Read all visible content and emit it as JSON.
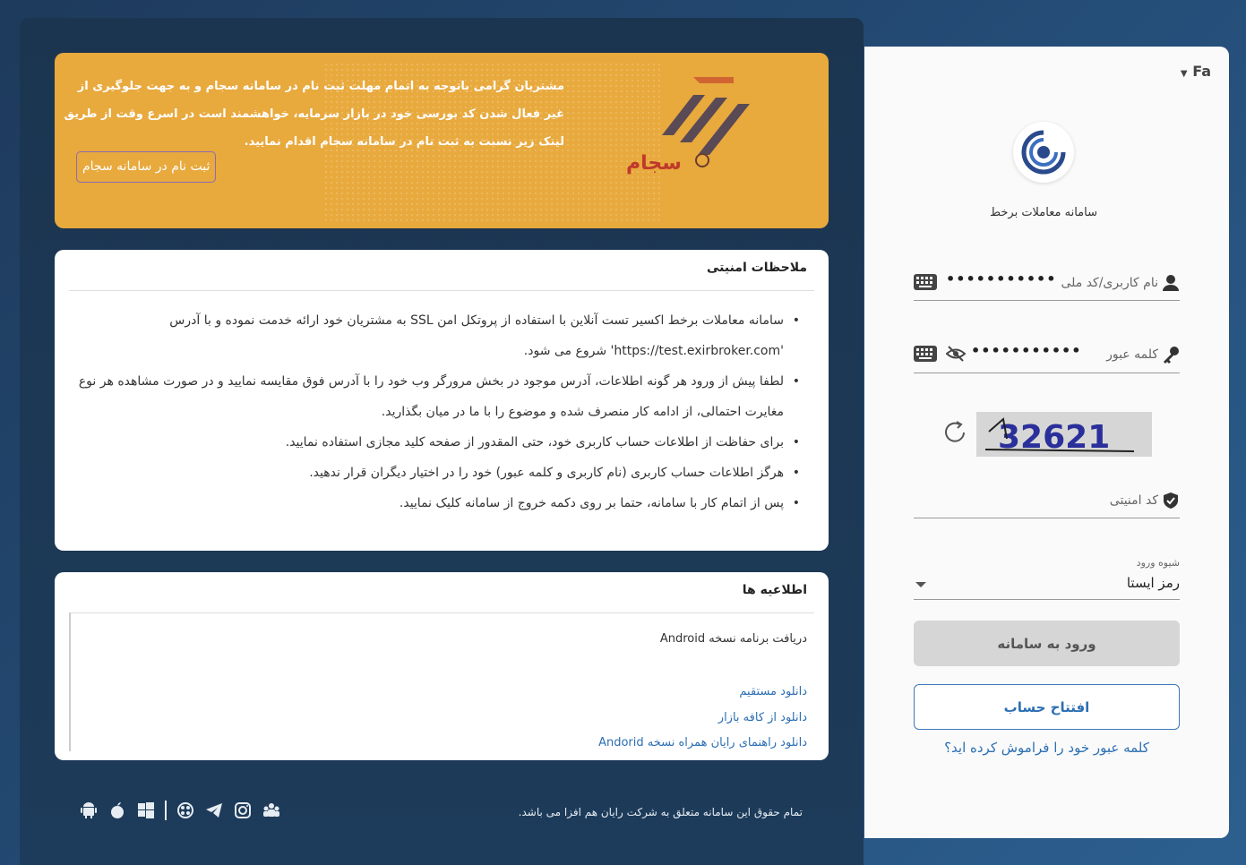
{
  "banner": {
    "text": "مشتریان گرامی باتوجه به اتمام مهلت ثبت نام در سامانه سجام و به جهت جلوگیری از غیر فعال شدن کد بورسی خود در بازار سرمایه، خواهشمند است در اسرع وقت از طریق لینک زیر نسبت به ثبت نام در سامانه سجام اقدام نمایید.",
    "button_label": "ثبت نام در سامانه سجام",
    "logo_text": "سجام"
  },
  "security": {
    "title": "ملاحظات امنیتی",
    "items": [
      "سامانه معاملات برخط اکسیر تست آنلاین با استفاده از پروتکل امن SSL به مشتریان خود ارائه خدمت نموده و با آدرس 'https://test.exirbroker.com' شروع می شود.",
      "لطفا پیش از ورود هر گونه اطلاعات، آدرس موجود در بخش مرورگر وب خود را با آدرس فوق مقایسه نمایید و در صورت مشاهده هر نوع مغایرت احتمالی، از ادامه کار منصرف شده و موضوع را با ما در میان بگذارید.",
      "برای حفاظت از اطلاعات حساب کاربری خود، حتی المقدور از صفحه کلید مجازی استفاده نمایید.",
      "هرگز اطلاعات حساب کاربری (نام کاربری و کلمه عبور) خود را در اختیار دیگران قرار ندهید.",
      "پس از اتمام کار با سامانه، حتما بر روی دکمه خروج از سامانه کلیک نمایید."
    ]
  },
  "news": {
    "title": "اطلاعیه ها",
    "heading": "دریافت برنامه نسخه Android",
    "links": [
      "دانلود مستقیم",
      "دانلود از کافه بازار",
      "دانلود راهنمای رایان همراه نسخه Andorid"
    ]
  },
  "footer": {
    "copyright": "تمام حقوق این سامانه متعلق به شرکت رایان هم افزا می باشد."
  },
  "login": {
    "lang": "Fa",
    "app_name": "سامانه معاملات برخط",
    "username_label": "نام کاربری/کد ملی",
    "username_value": "•••••••••••",
    "password_label": "کلمه عبور",
    "password_value": "•••••••••••",
    "captcha_text": "32621",
    "security_code_label": "کد امنیتی",
    "login_method_label": "شیوه ورود",
    "login_method_value": "رمز ایستا",
    "login_button": "ورود به سامانه",
    "open_account_button": "افتتاح حساب",
    "forgot_link": "کلمه عبور خود را فراموش کرده اید؟"
  },
  "colors": {
    "banner": "#e8a93d",
    "link": "#2c6fb3",
    "panel_dark": "#1b3550"
  }
}
